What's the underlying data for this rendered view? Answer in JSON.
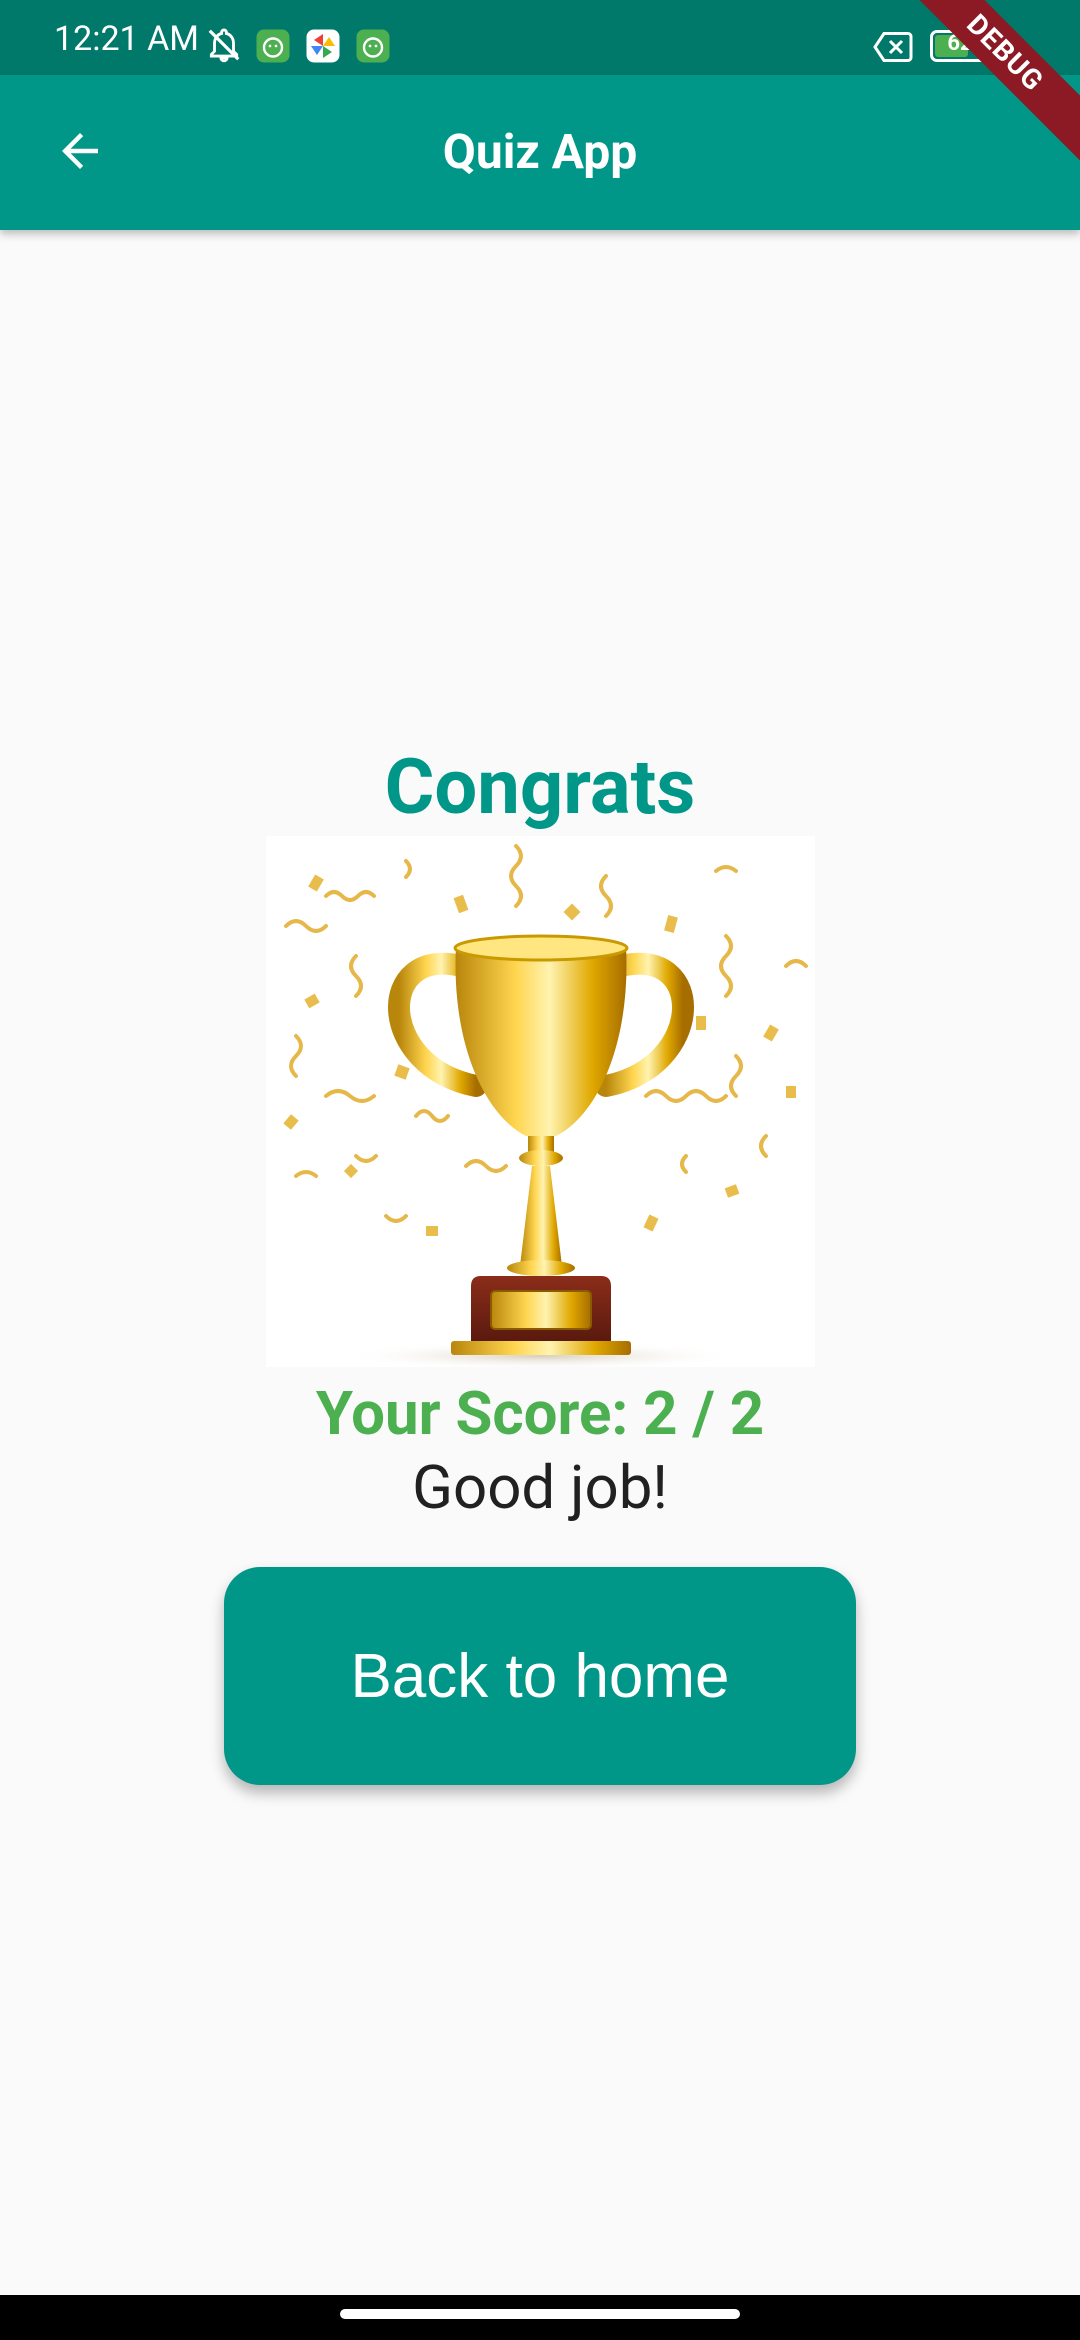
{
  "status_bar": {
    "time": "12:21 AM",
    "battery_level": "62",
    "icons": [
      "bell-off-icon",
      "app-notification-icon",
      "photos-icon",
      "app-notification-icon",
      "no-sim-icon",
      "battery-icon",
      "charging-icon"
    ]
  },
  "debug_banner": {
    "label": "DEBUG"
  },
  "app_bar": {
    "title": "Quiz App",
    "back_icon": "arrow-back-icon"
  },
  "result": {
    "heading": "Congrats",
    "image": "trophy-with-confetti",
    "score_text": "Your Score: 2 / 2",
    "message": "Good job!"
  },
  "actions": {
    "home_button_label": "Back to home"
  },
  "colors": {
    "primary": "#009688",
    "primary_dark": "#00796b",
    "score_green": "#4caf50",
    "background": "#fafafa",
    "debug_red": "#8b1a24"
  }
}
